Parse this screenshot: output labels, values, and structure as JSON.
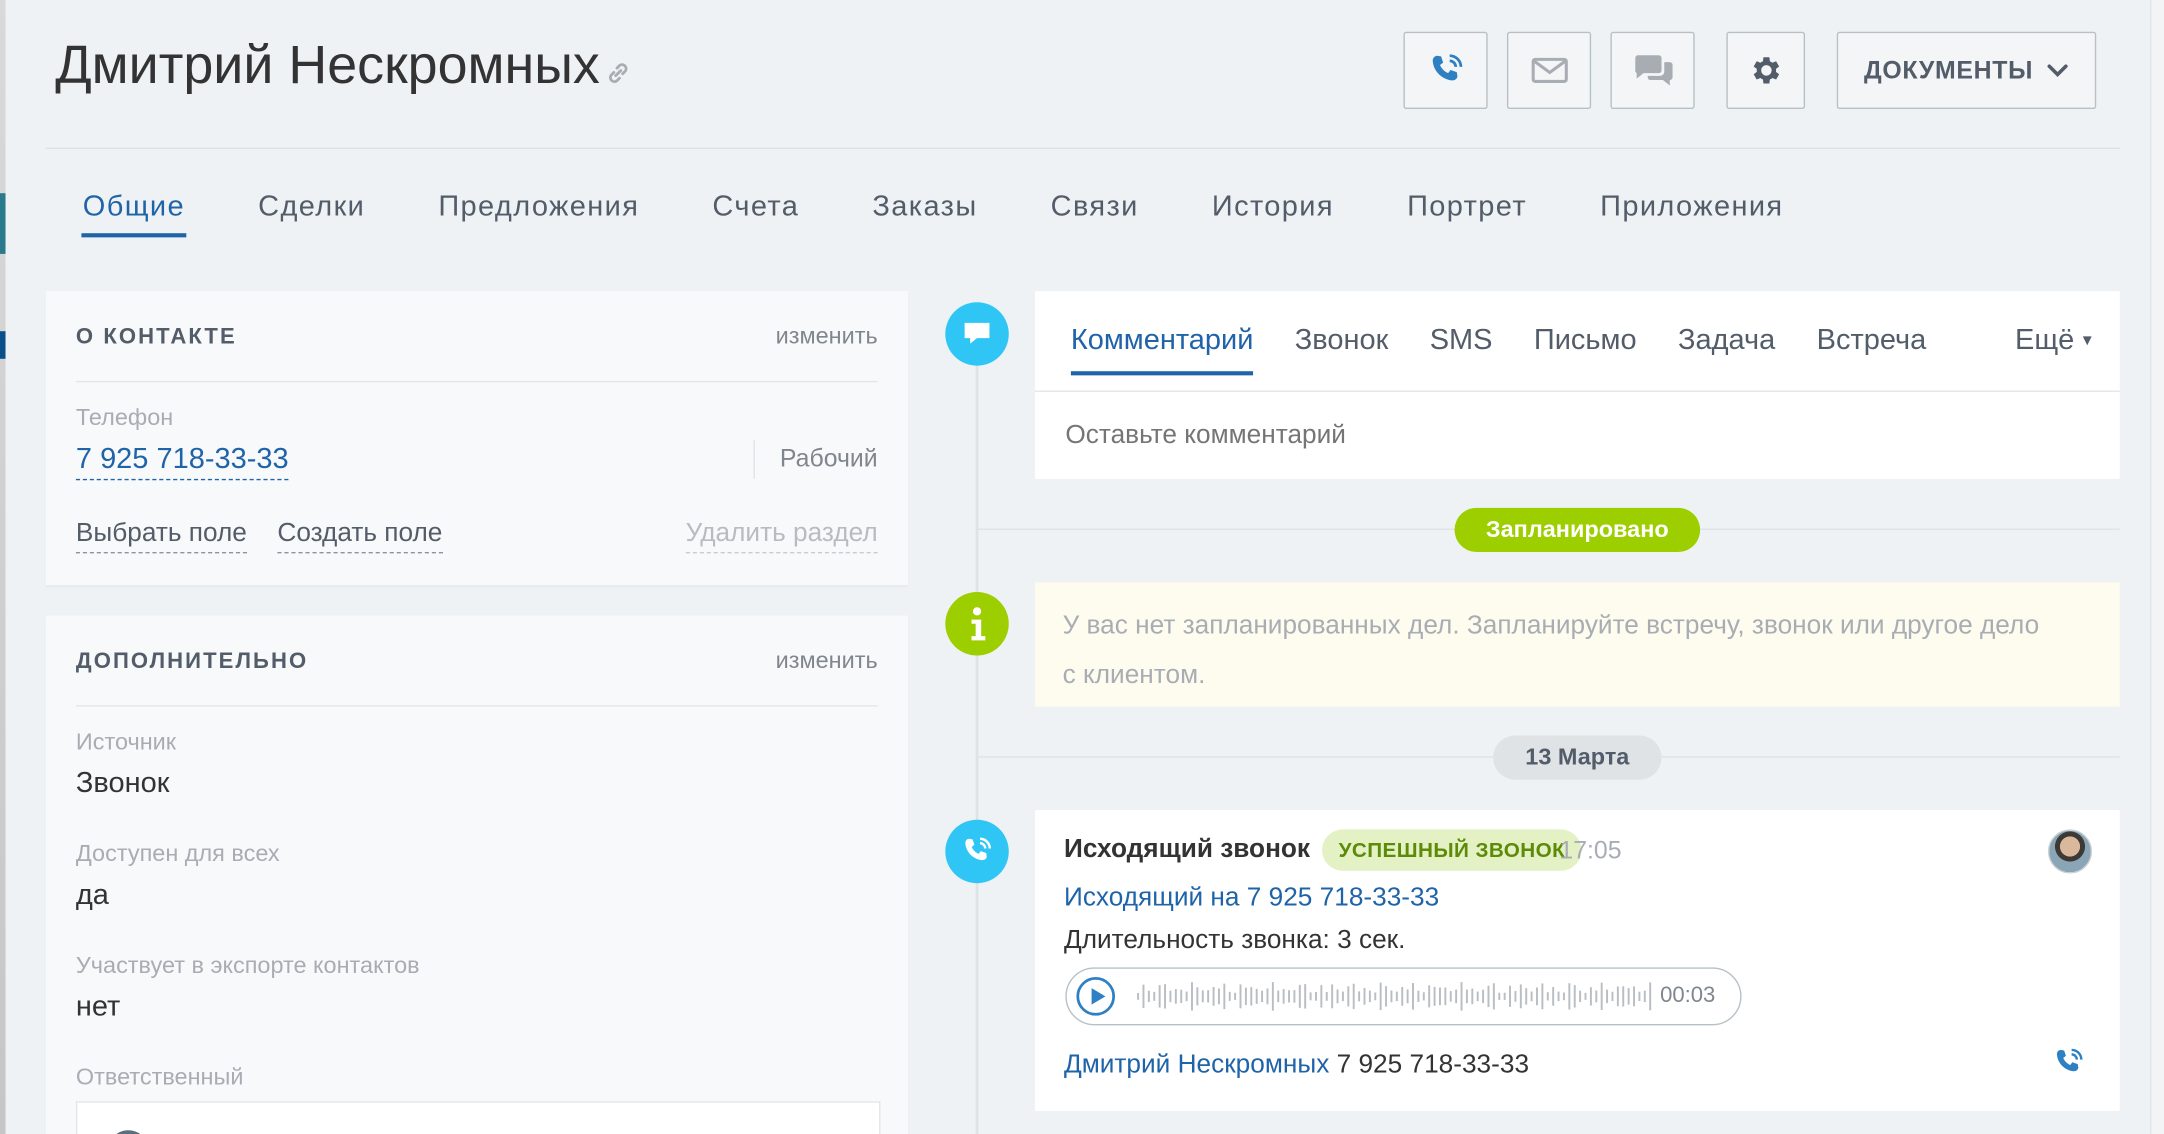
{
  "header": {
    "title": "Дмитрий Нескромных",
    "documents_label": "ДОКУМЕНТЫ"
  },
  "top_tabs": [
    {
      "label": "Общие",
      "active": true
    },
    {
      "label": "Сделки"
    },
    {
      "label": "Предложения"
    },
    {
      "label": "Счета"
    },
    {
      "label": "Заказы"
    },
    {
      "label": "Связи"
    },
    {
      "label": "История"
    },
    {
      "label": "Портрет"
    },
    {
      "label": "Приложения"
    }
  ],
  "contact_card": {
    "title": "О КОНТАКТЕ",
    "edit_label": "изменить",
    "phone_label": "Телефон",
    "phone_value": "7 925 718-33-33",
    "phone_type": "Рабочий",
    "select_field": "Выбрать поле",
    "create_field": "Создать поле",
    "delete_section": "Удалить раздел"
  },
  "extra_card": {
    "title": "ДОПОЛНИТЕЛЬНО",
    "edit_label": "изменить",
    "fields": [
      {
        "label": "Источник",
        "value": "Звонок"
      },
      {
        "label": "Доступен для всех",
        "value": "да"
      },
      {
        "label": "Участвует в экспорте контактов",
        "value": "нет"
      }
    ],
    "responsible_label": "Ответственный"
  },
  "editor": {
    "tabs": [
      {
        "label": "Комментарий",
        "active": true
      },
      {
        "label": "Звонок"
      },
      {
        "label": "SMS"
      },
      {
        "label": "Письмо"
      },
      {
        "label": "Задача"
      },
      {
        "label": "Встреча"
      }
    ],
    "more_label": "Ещё",
    "placeholder": "Оставьте комментарий"
  },
  "timeline": {
    "planned_badge": "Запланировано",
    "planned_info": "У вас нет запланированных дел. Запланируйте встречу, звонок или другое дело с клиентом.",
    "date_badge": "13 Марта",
    "call": {
      "title": "Исходящий звонок",
      "status": "УСПЕШНЫЙ ЗВОНОК",
      "time": "17:05",
      "link": "Исходящий на 7 925 718-33-33",
      "duration": "Длительность звонка: 3 сек.",
      "player_time": "00:03",
      "contact_name": "Дмитрий Нескромных",
      "contact_phone": "7 925 718-33-33"
    }
  },
  "colors": {
    "accent_blue": "#1f63a8",
    "timeline_cyan": "#2fc6f6",
    "planned_green": "#9dcf00"
  }
}
